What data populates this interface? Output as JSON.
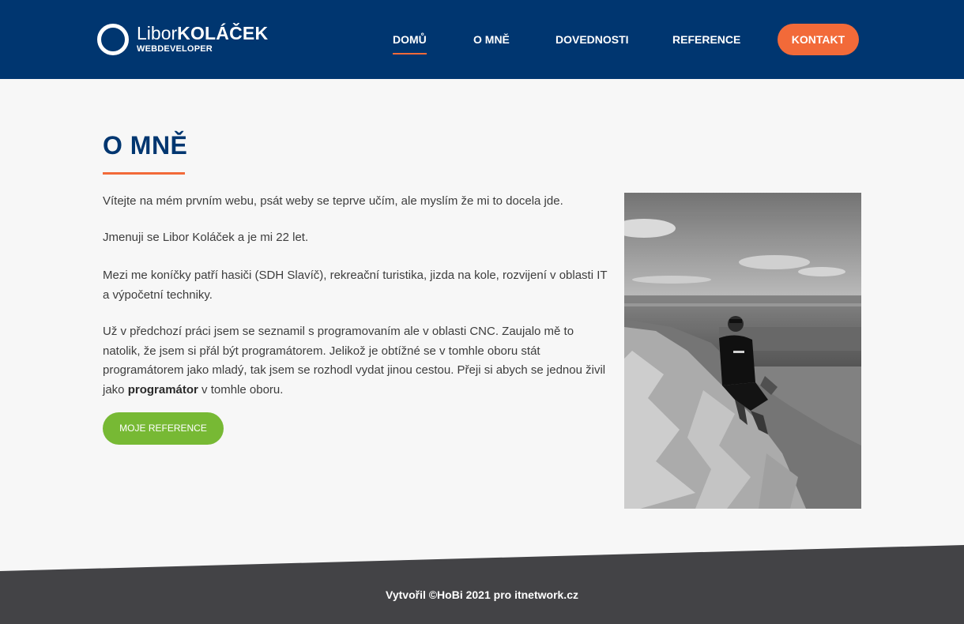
{
  "header": {
    "logo": {
      "first_name": "Libor",
      "last_name": "KOLÁČEK",
      "subtitle": "WEBDEVELOPER"
    },
    "nav": [
      {
        "label": "DOMŮ",
        "active": true
      },
      {
        "label": "O MNĚ",
        "active": false
      },
      {
        "label": "DOVEDNOSTI",
        "active": false
      },
      {
        "label": "REFERENCE",
        "active": false
      }
    ],
    "contact_label": "KONTAKT"
  },
  "main": {
    "title": "O MNĚ",
    "paragraphs": {
      "p1": "Vítejte na mém prvním webu, psát weby se teprve učím, ale myslím že mi to docela jde.",
      "p2": "Jmenuji se Libor Koláček a je mi 22 let.",
      "p3": "Mezi me koníčky patří hasiči (SDH Slavíč), rekreační turistika, jizda na kole, rozvijení v oblasti IT a výpočetní techniky.",
      "p4_before": "Už v předchozí práci jsem se seznamil s programovaním ale v oblasti CNC. Zaujalo mě to natolik, že jsem si přál být programátorem. Jelikož je obtížné se v tomhle oboru stát programátorem jako mladý, tak jsem se rozhodl vydat jinou cestou. Přeji si abych se jednou živil jako ",
      "p4_bold": "programátor",
      "p4_after": " v tomhle oboru."
    },
    "button_label": "MOJE REFERENCE"
  },
  "footer": {
    "text": "Vytvořil ©HoBi 2021 pro itnetwork.cz"
  },
  "colors": {
    "header_bg": "#003670",
    "accent_orange": "#f26a39",
    "button_green": "#77b934",
    "footer_bg": "#434346",
    "page_bg": "#f7f7f7"
  }
}
